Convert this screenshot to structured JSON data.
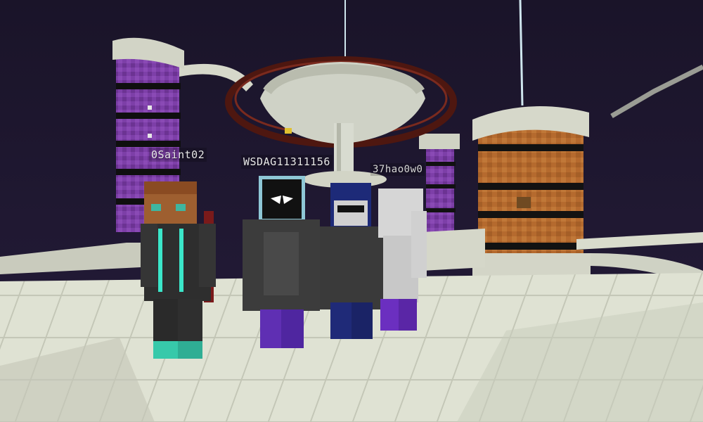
{
  "players": [
    {
      "name": "0Saint02"
    },
    {
      "name": "WSDAG11311156"
    },
    {
      "name": "37hao0w0"
    }
  ],
  "colors": {
    "sky": "#1c1530",
    "purple_pillar": "#7a3fa3",
    "orange_pillar": "#b8692c",
    "floor": "#dcdfd0",
    "ring": "#5c1a12"
  }
}
